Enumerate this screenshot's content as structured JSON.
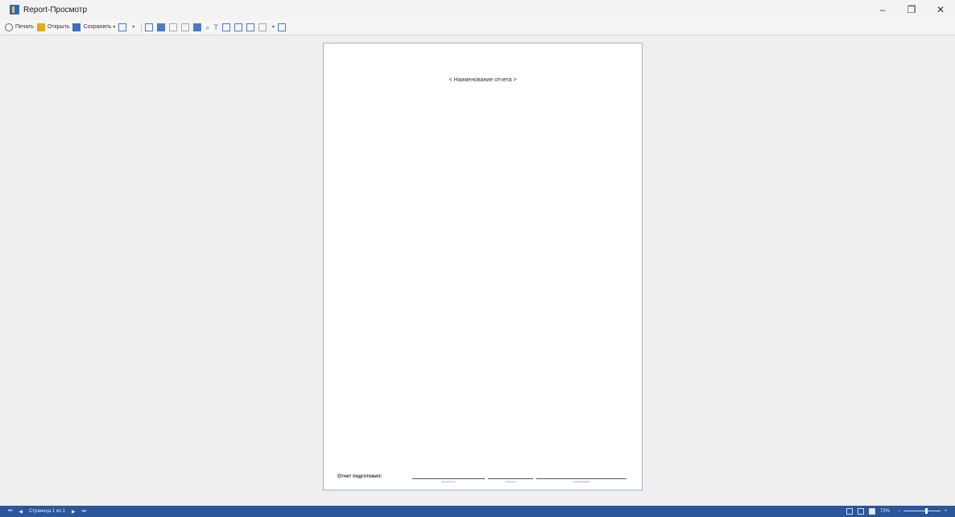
{
  "window": {
    "title": "Report-Просмотр",
    "minimize": "–",
    "restore": "❐",
    "close": "✕"
  },
  "toolbar": {
    "print_label": "Печать",
    "open_label": "Открыть",
    "save_label": "Сохранить",
    "caret": "▾"
  },
  "report": {
    "title": "< Наименование отчета >",
    "prepared_by_label": "Отчет подготовил:",
    "sig_position": "(должность)",
    "sig_signature": "(подпись)",
    "sig_name": "(расшифровка)"
  },
  "statusbar": {
    "first": "⏮",
    "prev": "◀",
    "page_info": "Страница 1 из 1",
    "next": "▶",
    "last": "⏭",
    "zoom": "73%",
    "zoom_minus": "−",
    "zoom_plus": "+"
  },
  "colors": {
    "accent": "#2b579a",
    "page_border": "#9db4d6"
  }
}
